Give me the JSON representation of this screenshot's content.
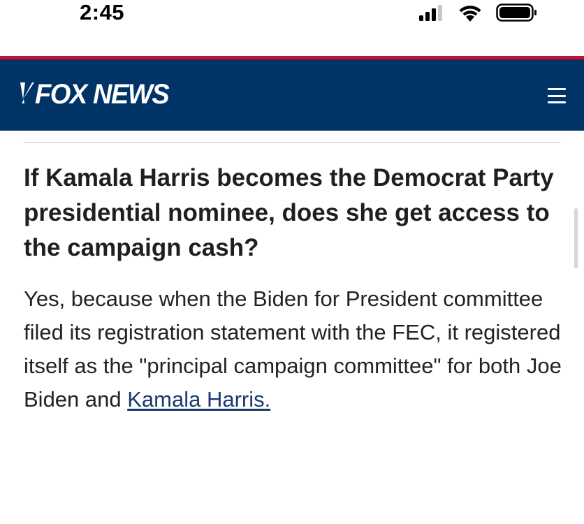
{
  "status_bar": {
    "time": "2:45"
  },
  "header": {
    "logo_text": "FOX NEWS",
    "brand_color": "#003366",
    "accent_color": "#c8102e",
    "menu_icon": "hamburger-menu-icon"
  },
  "article": {
    "heading": "If Kamala Harris becomes the Democrat Party presidential nominee, does she get access to the campaign cash?",
    "body_text": "Yes, because when the Biden for President committee filed its registration statement with the FEC, it registered itself as the \"principal campaign committee\" for both Joe Biden and ",
    "link_text": "Kamala Harris."
  }
}
